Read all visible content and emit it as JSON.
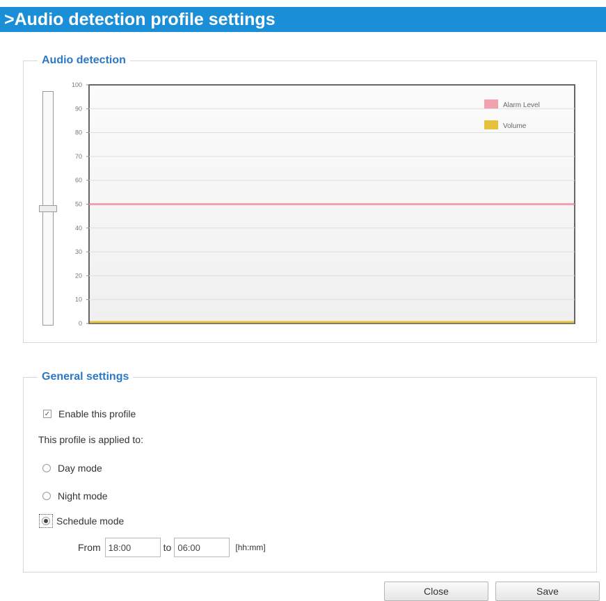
{
  "page_title": ">Audio detection profile settings",
  "audio_detection": {
    "legend": "Audio detection",
    "slider_value": 50,
    "chart_data": {
      "type": "line",
      "ylim": [
        0,
        100
      ],
      "y_ticks": [
        "100",
        "90",
        "80",
        "70",
        "60",
        "50",
        "40",
        "30",
        "20",
        "10",
        "0"
      ],
      "series": [
        {
          "name": "Alarm Level",
          "color": "#f0a3ae",
          "value": 50
        },
        {
          "name": "Volume",
          "color": "#e6c23c",
          "value": 0
        }
      ],
      "grid": true,
      "legend_position": "top-right"
    }
  },
  "general_settings": {
    "legend": "General settings",
    "enable_profile": {
      "label": "Enable this profile",
      "checked": true
    },
    "applied_to_label": "This profile is applied to:",
    "modes": [
      {
        "label": "Day mode",
        "checked": false
      },
      {
        "label": "Night mode",
        "checked": false
      },
      {
        "label": "Schedule mode",
        "checked": true
      }
    ],
    "schedule": {
      "from_label": "From",
      "from_value": "18:00",
      "to_label": "to",
      "to_value": "06:00",
      "format_hint": "[hh:mm]"
    }
  },
  "buttons": {
    "close": "Close",
    "save": "Save"
  }
}
